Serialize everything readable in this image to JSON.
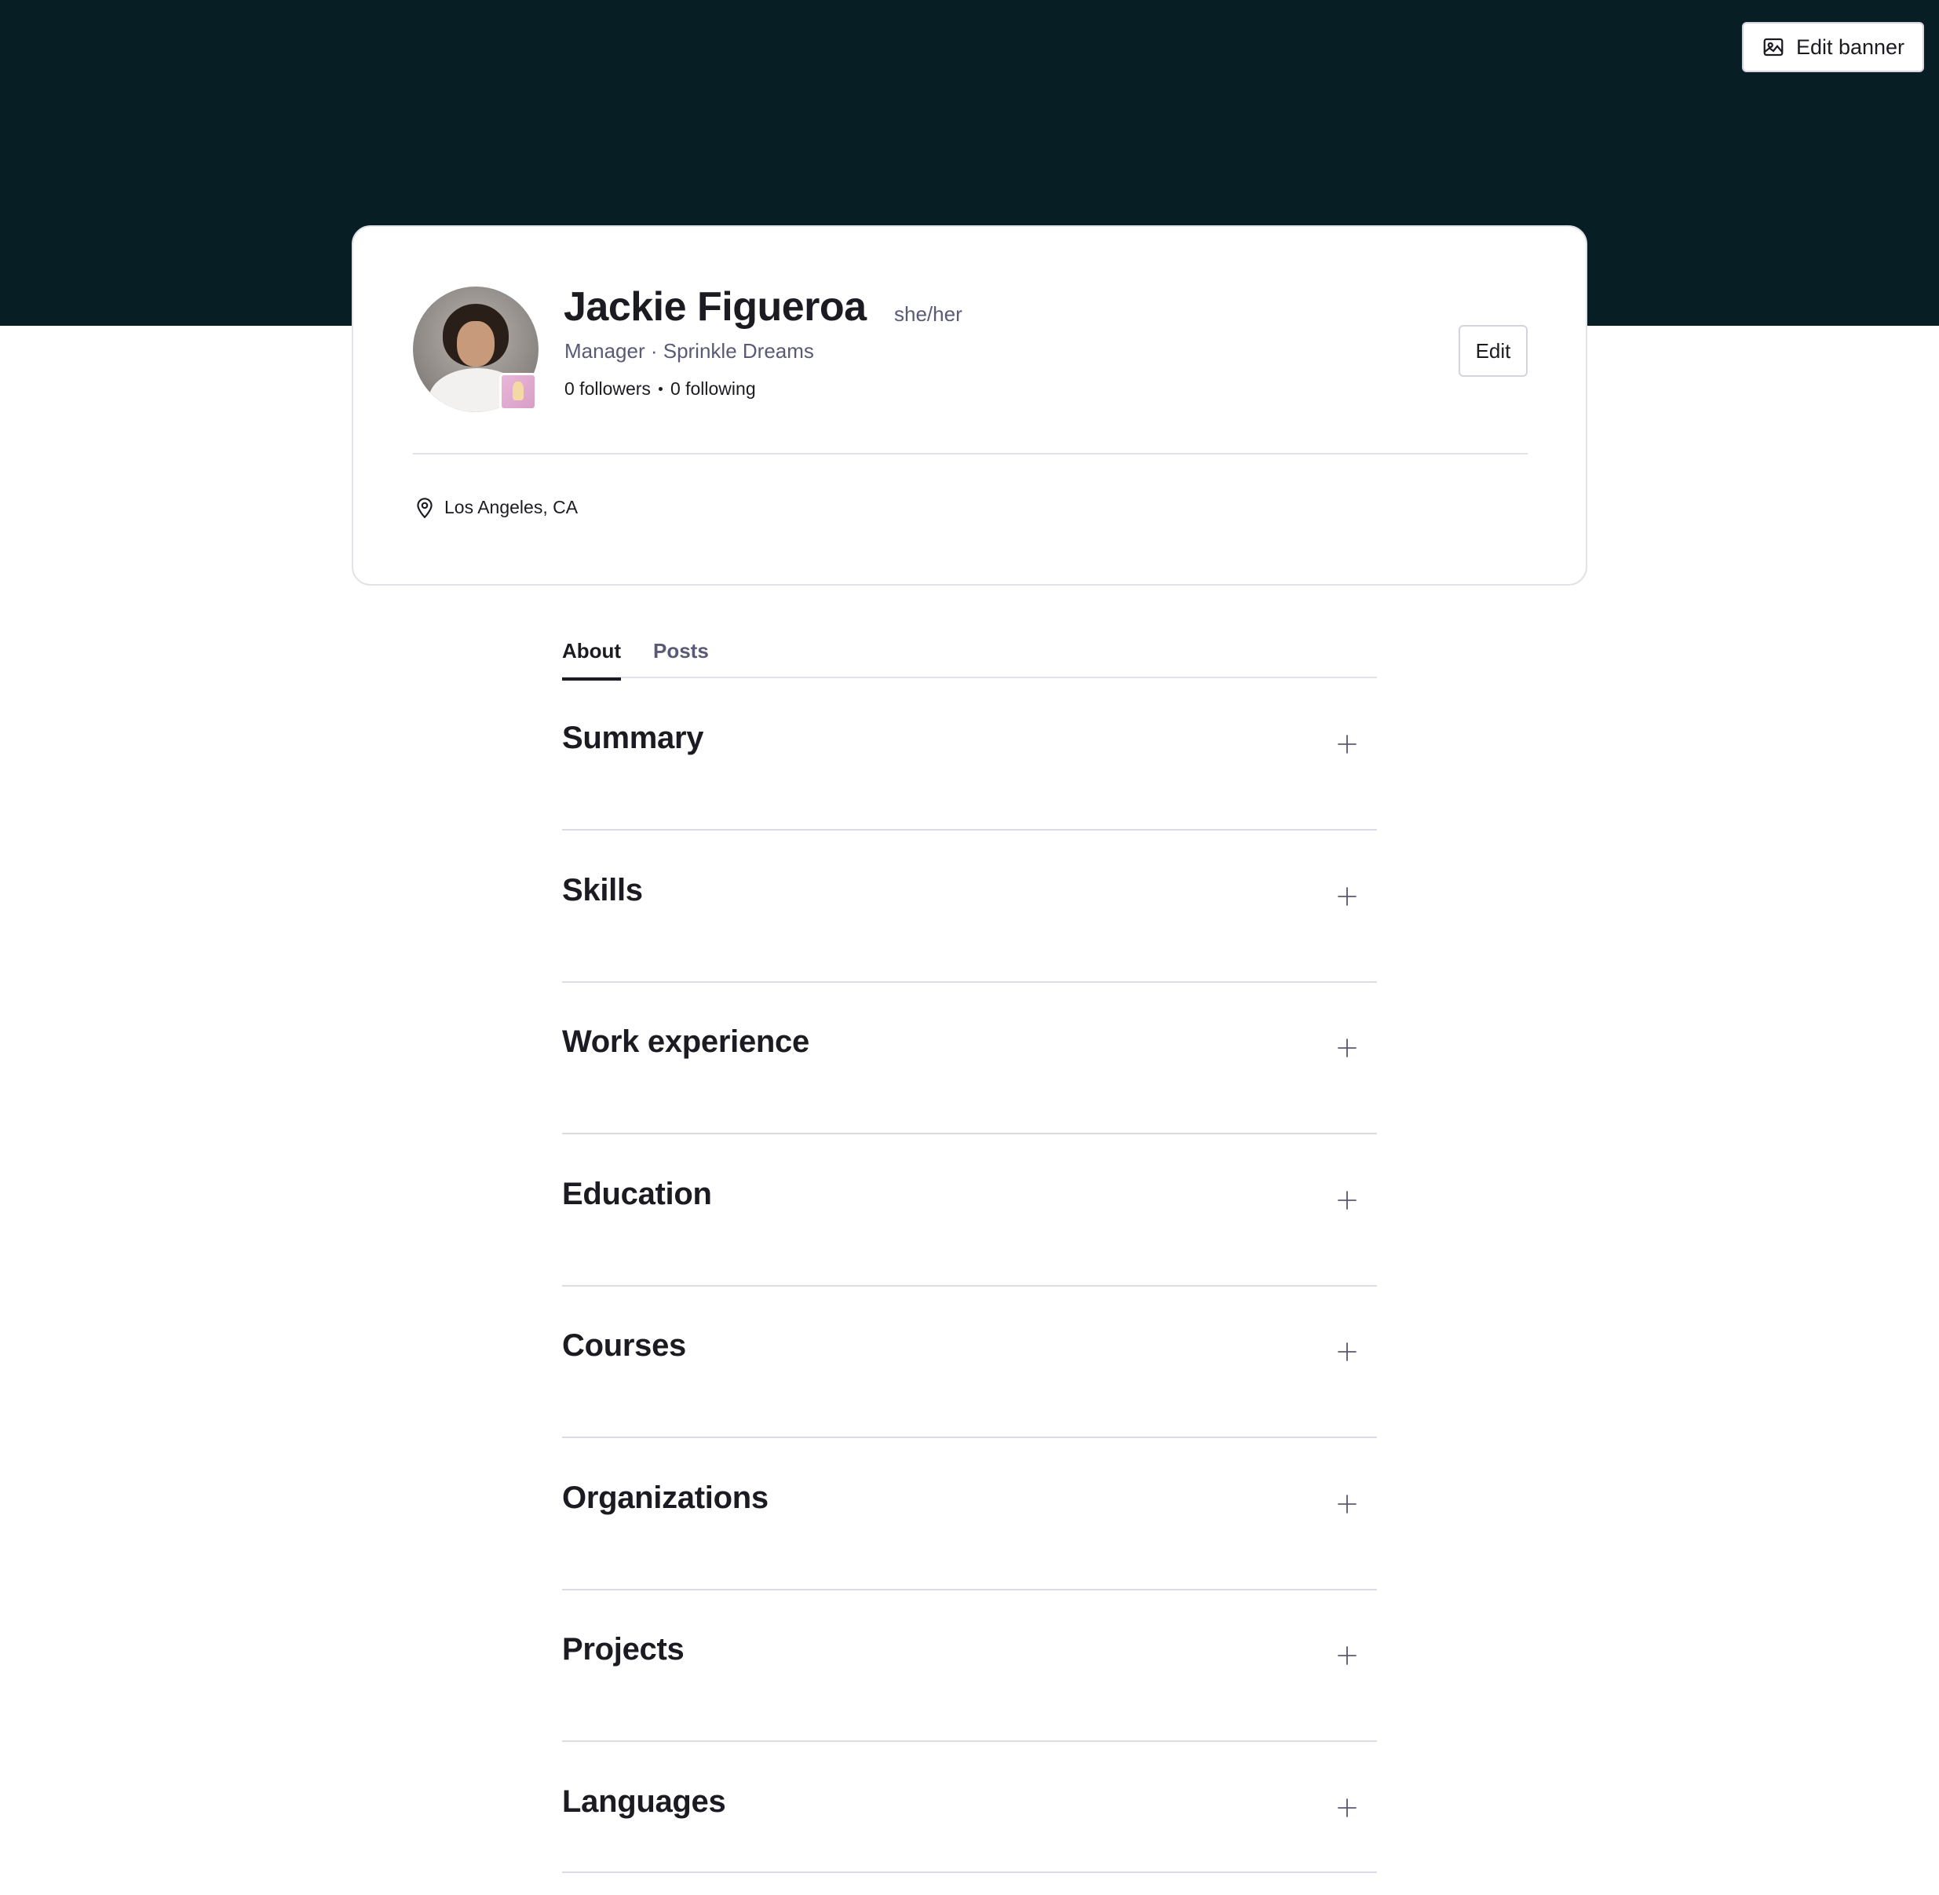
{
  "banner": {
    "edit_label": "Edit banner",
    "background_color": "#071f24",
    "icon": "image-icon"
  },
  "profile": {
    "name": "Jackie Figueroa",
    "pronouns": "she/her",
    "headline": "Manager · Sprinkle Dreams",
    "followers": "0 followers",
    "following": "0 following",
    "location": "Los Angeles, CA",
    "location_icon": "map-pin-icon",
    "edit_label": "Edit"
  },
  "tabs": [
    {
      "label": "About",
      "active": true
    },
    {
      "label": "Posts",
      "active": false
    }
  ],
  "sections": [
    {
      "title": "Summary",
      "action_icon": "plus-icon"
    },
    {
      "title": "Skills",
      "action_icon": "plus-icon"
    },
    {
      "title": "Work experience",
      "action_icon": "plus-icon"
    },
    {
      "title": "Education",
      "action_icon": "plus-icon"
    },
    {
      "title": "Courses",
      "action_icon": "plus-icon"
    },
    {
      "title": "Organizations",
      "action_icon": "plus-icon"
    },
    {
      "title": "Projects",
      "action_icon": "plus-icon"
    },
    {
      "title": "Languages",
      "action_icon": "plus-icon"
    }
  ]
}
